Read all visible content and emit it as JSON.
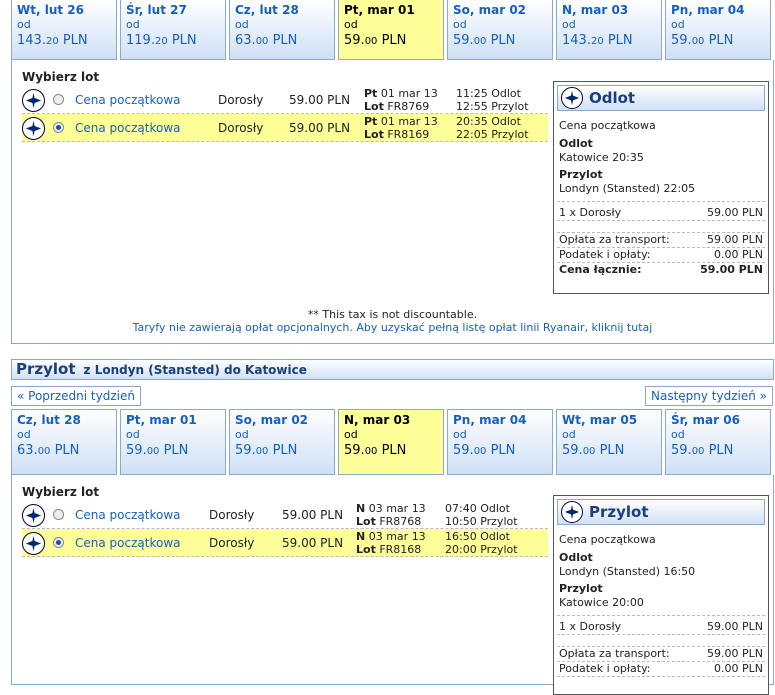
{
  "departure": {
    "dates": [
      {
        "day": "Wt, lut 26",
        "od": "od",
        "price_main": "143.",
        "price_dec": "20",
        "currency": "PLN",
        "selected": false
      },
      {
        "day": "Śr, lut 27",
        "od": "od",
        "price_main": "119.",
        "price_dec": "20",
        "currency": "PLN",
        "selected": false
      },
      {
        "day": "Cz, lut 28",
        "od": "od",
        "price_main": "63.",
        "price_dec": "00",
        "currency": "PLN",
        "selected": false
      },
      {
        "day": "Pt, mar 01",
        "od": "od",
        "price_main": "59.",
        "price_dec": "00",
        "currency": "PLN",
        "selected": true
      },
      {
        "day": "So, mar 02",
        "od": "od",
        "price_main": "59.",
        "price_dec": "00",
        "currency": "PLN",
        "selected": false
      },
      {
        "day": "N, mar 03",
        "od": "od",
        "price_main": "143.",
        "price_dec": "20",
        "currency": "PLN",
        "selected": false
      },
      {
        "day": "Pn, mar 04",
        "od": "od",
        "price_main": "59.",
        "price_dec": "00",
        "currency": "PLN",
        "selected": false
      }
    ],
    "select_label": "Wybierz lot",
    "flights": [
      {
        "fare": "Cena początkowa",
        "pax": "Dorosły",
        "price": "59.00 PLN",
        "day_bold": "Pt",
        "date": "01 mar 13",
        "lot_label": "Lot",
        "flight_no": "FR8769",
        "dep": "11:25 Odlot",
        "arr": "12:55 Przylot",
        "selected": false
      },
      {
        "fare": "Cena początkowa",
        "pax": "Dorosły",
        "price": "59.00 PLN",
        "day_bold": "Pt",
        "date": "01 mar 13",
        "lot_label": "Lot",
        "flight_no": "FR8169",
        "dep": "20:35 Odlot",
        "arr": "22:05 Przylot",
        "selected": true
      }
    ],
    "summary": {
      "title": "Odlot",
      "fare": "Cena początkowa",
      "dep_label": "Odlot",
      "dep_value": "Katowice 20:35",
      "arr_label": "Przylot",
      "arr_value": "Londyn (Stansted) 22:05",
      "pax_label": "1 x Dorosły",
      "pax_value": "59.00 PLN",
      "transport_label": "Opłata za transport:",
      "transport_value": "59.00 PLN",
      "tax_label": "Podatek i opłaty:",
      "tax_value": "0.00 PLN",
      "total_label": "Cena łącznie:",
      "total_value": "59.00 PLN"
    },
    "tax_note": "** This tax is not discountable.",
    "fees_note": "Taryfy nie zawierają opłat opcjonalnych. Aby uzyskać pełną listę opłat linii Ryanair, kliknij tutaj"
  },
  "return": {
    "title": "Przylot",
    "route": "z Londyn (Stansted) do Katowice",
    "prev_week": "« Poprzedni tydzień",
    "next_week": "Następny tydzień »",
    "dates": [
      {
        "day": "Cz, lut 28",
        "od": "od",
        "price_main": "63.",
        "price_dec": "00",
        "currency": "PLN",
        "selected": false
      },
      {
        "day": "Pt, mar 01",
        "od": "od",
        "price_main": "59.",
        "price_dec": "00",
        "currency": "PLN",
        "selected": false
      },
      {
        "day": "So, mar 02",
        "od": "od",
        "price_main": "59.",
        "price_dec": "00",
        "currency": "PLN",
        "selected": false
      },
      {
        "day": "N, mar 03",
        "od": "od",
        "price_main": "59.",
        "price_dec": "00",
        "currency": "PLN",
        "selected": true
      },
      {
        "day": "Pn, mar 04",
        "od": "od",
        "price_main": "59.",
        "price_dec": "00",
        "currency": "PLN",
        "selected": false
      },
      {
        "day": "Wt, mar 05",
        "od": "od",
        "price_main": "59.",
        "price_dec": "00",
        "currency": "PLN",
        "selected": false
      },
      {
        "day": "Śr, mar 06",
        "od": "od",
        "price_main": "59.",
        "price_dec": "00",
        "currency": "PLN",
        "selected": false
      }
    ],
    "select_label": "Wybierz lot",
    "flights": [
      {
        "fare": "Cena początkowa",
        "pax": "Dorosły",
        "price": "59.00 PLN",
        "day_bold": "N",
        "date": "03 mar 13",
        "lot_label": "Lot",
        "flight_no": "FR8768",
        "dep": "07:40 Odlot",
        "arr": "10:50 Przylot",
        "selected": false
      },
      {
        "fare": "Cena początkowa",
        "pax": "Dorosły",
        "price": "59.00 PLN",
        "day_bold": "N",
        "date": "03 mar 13",
        "lot_label": "Lot",
        "flight_no": "FR8168",
        "dep": "16:50 Odlot",
        "arr": "20:00 Przylot",
        "selected": true
      }
    ],
    "summary": {
      "title": "Przylot",
      "fare": "Cena początkowa",
      "dep_label": "Odlot",
      "dep_value": "Londyn (Stansted) 16:50",
      "arr_label": "Przylot",
      "arr_value": "Katowice 20:00",
      "pax_label": "1 x Dorosły",
      "pax_value": "59.00 PLN",
      "transport_label": "Opłata za transport:",
      "transport_value": "59.00 PLN",
      "tax_label": "Podatek i opłaty:",
      "tax_value": "0.00 PLN"
    }
  },
  "colors": {
    "accent": "#1560bd",
    "selected": "#ffff99",
    "border": "#8aa9cf"
  }
}
